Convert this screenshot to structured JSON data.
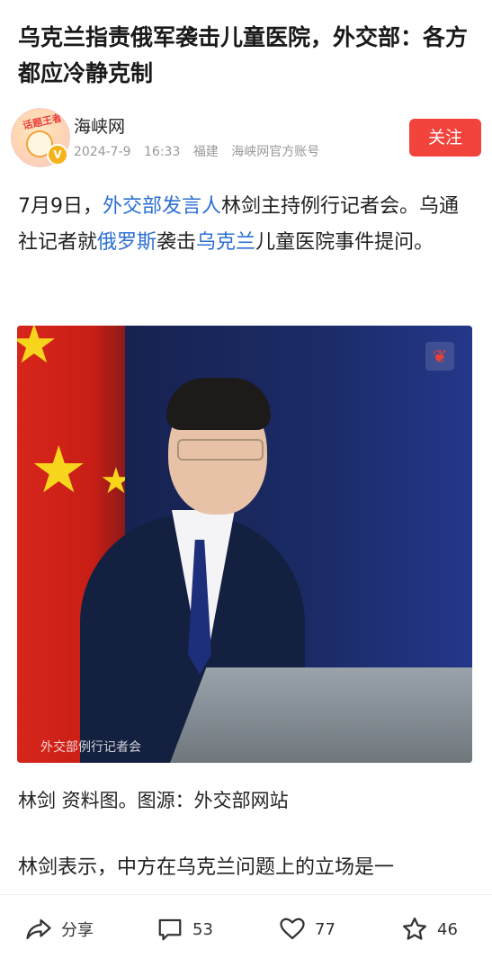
{
  "article": {
    "title": "乌克兰指责俄军袭击儿童医院，外交部：各方都应冷静克制"
  },
  "author": {
    "name": "海峡网",
    "date": "2024-7-9",
    "time": "16:33",
    "location": "福建",
    "account_type": "海峡网官方账号",
    "avatar_text": "话题王者",
    "verified_badge": "V",
    "follow_label": "关注"
  },
  "paragraph1": {
    "s1": "7月9日，",
    "link1": "外交部发言人",
    "s2": "林剑主持例行记者会。乌通社记者就",
    "link2": "俄罗斯",
    "s3": "袭击",
    "link3": "乌克兰",
    "s4": "儿童医院事件提问。"
  },
  "photo": {
    "watermark": "外交部例行记者会"
  },
  "caption": "林剑 资料图。图源：外交部网站",
  "paragraph2": "林剑表示，中方在乌克兰问题上的立场是一",
  "bottom_bar": {
    "share_label": "分享",
    "comment_count": "53",
    "like_count": "77",
    "favorite_count": "46"
  },
  "colors": {
    "accent": "#f2433d",
    "link": "#2c6fd1"
  }
}
